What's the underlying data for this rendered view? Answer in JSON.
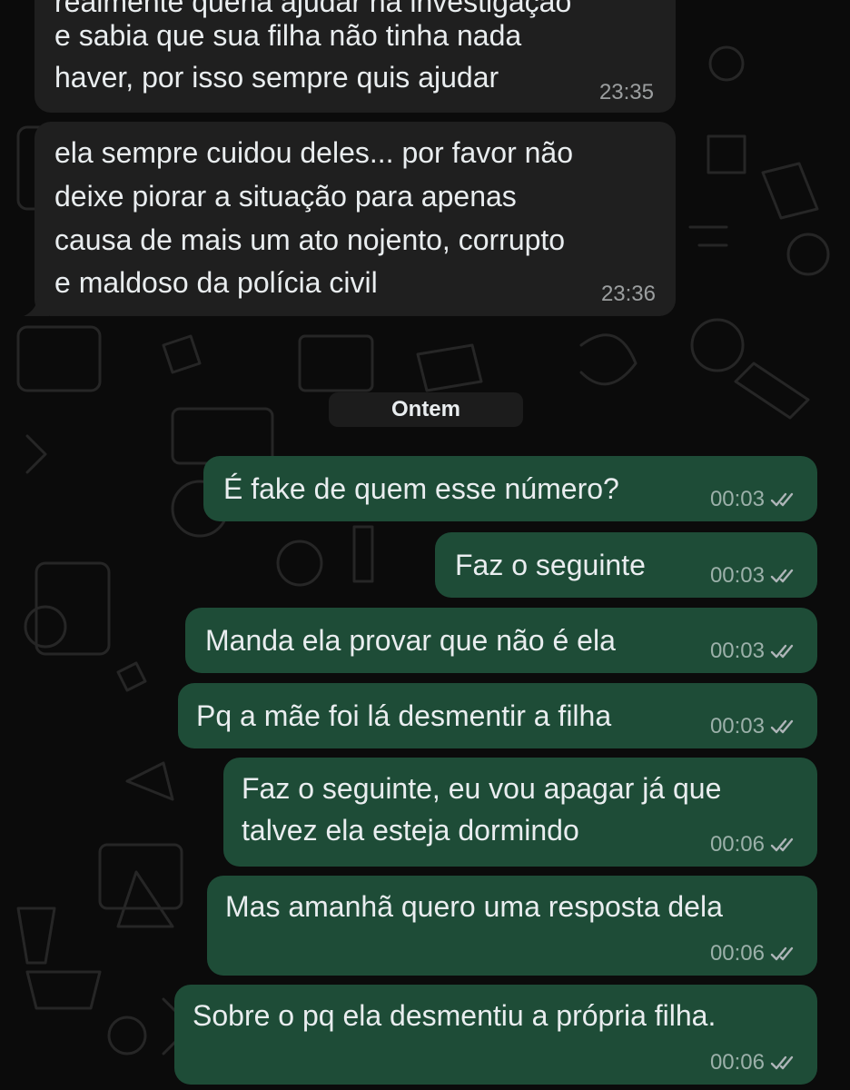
{
  "incoming": [
    {
      "lines": [
        "realmente queria ajudar na investigação",
        "e sabia que sua filha não tinha nada",
        "haver, por isso sempre quis ajudar"
      ],
      "time": "23:35"
    },
    {
      "lines": [
        "ela sempre cuidou deles... por favor não",
        "deixe piorar a situação para apenas",
        "causa de mais um ato nojento, corrupto",
        "e maldoso da polícia civil"
      ],
      "time": "23:36"
    }
  ],
  "date_separator": "Ontem",
  "outgoing": [
    {
      "lines": [
        "É fake de quem esse número?"
      ],
      "time": "00:03",
      "status": "read"
    },
    {
      "lines": [
        "Faz o seguinte"
      ],
      "time": "00:03",
      "status": "read"
    },
    {
      "lines": [
        "Manda ela provar que não é ela"
      ],
      "time": "00:03",
      "status": "read"
    },
    {
      "lines": [
        "Pq a mãe foi lá desmentir a filha"
      ],
      "time": "00:03",
      "status": "read"
    },
    {
      "lines": [
        "Faz o seguinte, eu vou apagar já que",
        "talvez ela esteja dormindo"
      ],
      "time": "00:06",
      "status": "read"
    },
    {
      "lines": [
        "Mas amanhã quero uma resposta dela"
      ],
      "time": "00:06",
      "status": "read"
    },
    {
      "lines": [
        "Sobre o pq ela desmentiu a própria filha."
      ],
      "time": "00:06",
      "status": "read"
    }
  ],
  "colors": {
    "background": "#0b0b0b",
    "incoming_bubble": "#1f1f1f",
    "outgoing_bubble": "#1e4c37",
    "meta_text": "#9aa1a4",
    "doodle": "#2a2a2a"
  }
}
